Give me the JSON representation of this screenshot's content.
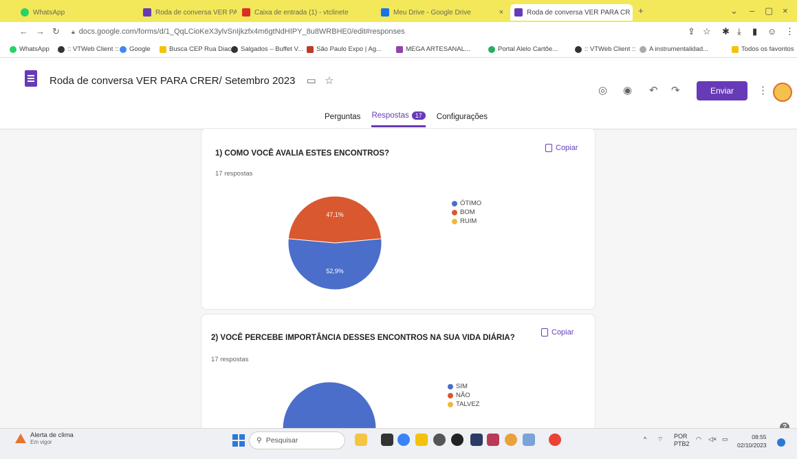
{
  "browser": {
    "tabs": [
      {
        "title": "WhatsApp",
        "icon": "whatsapp-icon",
        "color": "#25d366"
      },
      {
        "title": "Roda de conversa VER PARA CR",
        "icon": "forms-icon",
        "color": "#673ab7"
      },
      {
        "title": "Caixa de entrada (1) - vtclinete",
        "icon": "gmail-icon",
        "color": "#d93025"
      },
      {
        "title": "Meu Drive - Google Drive",
        "icon": "drive-icon",
        "color": "#1a73e8"
      },
      {
        "title": "Roda de conversa VER PARA CR",
        "icon": "forms-icon",
        "color": "#673ab7"
      }
    ],
    "url": "docs.google.com/forms/d/1_QqLCioKeX3ylvSnIjkzfx4m6gtNdHIPY_8u8WRBHE0/edit#responses",
    "bookmarks": [
      {
        "label": "WhatsApp",
        "color": "#25d366"
      },
      {
        "label": ":: VTWeb Client ::",
        "color": "#333333"
      },
      {
        "label": "Google",
        "color": "#4285f4"
      },
      {
        "label": "Busca CEP Rua Diac...",
        "color": "#f4c20d"
      },
      {
        "label": "Salgados – Buffet V...",
        "color": "#333333"
      },
      {
        "label": "São Paulo Expo | Ag...",
        "color": "#c0392b"
      },
      {
        "label": "MEGA ARTESANAL...",
        "color": "#8e44ad"
      },
      {
        "label": "Portal Alelo Cartõe...",
        "color": "#27ae60"
      },
      {
        "label": ":: VTWeb Client ::",
        "color": "#333333"
      },
      {
        "label": "A instrumentalidad...",
        "color": "#aaaaaa"
      }
    ],
    "all_bookmarks": "Todos os favoritos"
  },
  "form": {
    "title": "Roda de conversa VER PARA CRER/ Setembro 2023",
    "send_label": "Enviar",
    "tabs": {
      "questions": "Perguntas",
      "responses": "Respostas",
      "responses_count": "17",
      "settings": "Configurações"
    }
  },
  "questions": [
    {
      "title": "1) COMO VOCÊ AVALIA ESTES ENCONTROS?",
      "responses": "17 respostas",
      "copy_label": "Copiar",
      "legend": [
        "ÓTIMO",
        "BOM",
        "RUIM"
      ]
    },
    {
      "title": "2) VOCÊ PERCEBE IMPORTÂNCIA DESSES ENCONTROS NA SUA VIDA DIÁRIA?",
      "responses": "17 respostas",
      "copy_label": "Copiar",
      "legend": [
        "SIM",
        "NÃO",
        "TALVEZ"
      ]
    }
  ],
  "chart_data": [
    {
      "type": "pie",
      "categories": [
        "ÓTIMO",
        "BOM",
        "RUIM"
      ],
      "values": [
        52.9,
        47.1,
        0
      ],
      "labels": [
        "52,9%",
        "47,1%",
        ""
      ],
      "colors": [
        "#4a6ec9",
        "#d9582f",
        "#f0b73a"
      ]
    },
    {
      "type": "pie",
      "categories": [
        "SIM",
        "NÃO",
        "TALVEZ"
      ],
      "values": [
        100,
        0,
        0
      ],
      "colors": [
        "#4a6ec9",
        "#d9582f",
        "#f0b73a"
      ]
    }
  ],
  "taskbar": {
    "weather_title": "Alerta de clima",
    "weather_sub": "Em vigor",
    "search_placeholder": "Pesquisar",
    "lang": "POR",
    "lang_sub": "PTB2",
    "time": "08:55",
    "date": "02/10/2023"
  }
}
